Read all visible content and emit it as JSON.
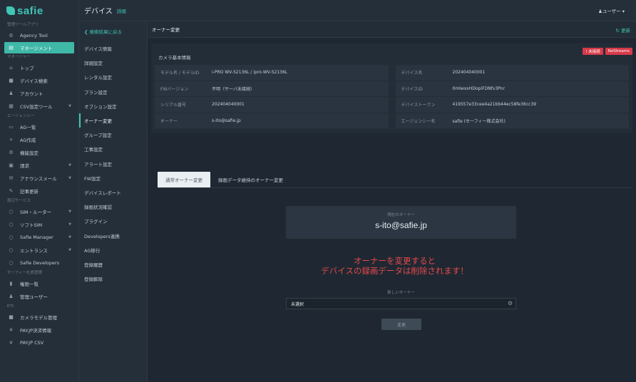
{
  "brand": "safie",
  "topbar": {
    "title": "デバイス",
    "subtitle": "詳細",
    "user": "♟ユーザー ▾"
  },
  "sidebar": {
    "sections": [
      {
        "title": "管理ツールアプリ",
        "items": [
          {
            "label": "Agency Tool",
            "icon": "tool-icon",
            "glyph": "⚙"
          },
          {
            "label": "マネージメント",
            "icon": "management-icon",
            "glyph": "▤",
            "active": true
          }
        ]
      },
      {
        "title": "マネージャー",
        "items": [
          {
            "label": "トップ",
            "icon": "home-icon",
            "glyph": "⌂"
          },
          {
            "label": "デバイス検索",
            "icon": "camera-icon",
            "glyph": "■"
          },
          {
            "label": "アカウント",
            "icon": "user-icon",
            "glyph": "♟"
          },
          {
            "label": "CSV設定ツール",
            "icon": "csv-icon",
            "glyph": "▦",
            "caret": true
          }
        ]
      },
      {
        "title": "エージェンシー",
        "items": [
          {
            "label": "AG一覧",
            "icon": "inbox-icon",
            "glyph": "▭"
          },
          {
            "label": "AG作成",
            "icon": "plus-icon",
            "glyph": "+"
          },
          {
            "label": "機能設定",
            "icon": "cogs-icon",
            "glyph": "⚙"
          },
          {
            "label": "請求",
            "icon": "invoice-icon",
            "glyph": "▣",
            "caret": true
          },
          {
            "label": "アナウンスメール",
            "icon": "mail-icon",
            "glyph": "✉",
            "caret": true
          },
          {
            "label": "記事更新",
            "icon": "edit-icon",
            "glyph": "✎"
          }
        ]
      },
      {
        "title": "周辺サービス",
        "items": [
          {
            "label": "SIM・ルーター",
            "icon": "circle-icon",
            "glyph": "○",
            "caret": true
          },
          {
            "label": "ソフトSIM",
            "icon": "circle-icon",
            "glyph": "○",
            "caret": true
          },
          {
            "label": "Safie Manager",
            "icon": "circle-icon",
            "glyph": "○",
            "caret": true
          },
          {
            "label": "エントランス",
            "icon": "circle-icon",
            "glyph": "○",
            "caret": true
          },
          {
            "label": "Safie Developers",
            "icon": "circle-icon",
            "glyph": "○"
          }
        ]
      },
      {
        "title": "セーフィー社員管理",
        "items": [
          {
            "label": "権限一覧",
            "icon": "lock-icon",
            "glyph": "▮"
          },
          {
            "label": "管理ユーザー",
            "icon": "user-icon",
            "glyph": "♟"
          }
        ]
      },
      {
        "title": "ETC",
        "items": [
          {
            "label": "カメラモデル管理",
            "icon": "video-icon",
            "glyph": "■"
          },
          {
            "label": "PAY.JP決済情報",
            "icon": "yen-icon",
            "glyph": "¥"
          },
          {
            "label": "PAY.JP CSV",
            "icon": "yen-icon",
            "glyph": "¥"
          }
        ]
      }
    ]
  },
  "subnav": {
    "back": "❮ 検索結果に戻る",
    "items": [
      "デバイス情報",
      "詳細設定",
      "レンタル設定",
      "プラン設定",
      "オプション設定",
      "オーナー変更",
      "グループ設定",
      "工事設定",
      "アラート設定",
      "FW設定",
      "デバイスレポート",
      "録画状況確認",
      "プラグイン",
      "Developers連携",
      "AG移行",
      "登録履歴",
      "登録解除"
    ],
    "active_index": 5
  },
  "panel": {
    "title": "オーナー変更",
    "refresh": "↻ 更新"
  },
  "camera_info": {
    "title": "カメラ基本情報",
    "badges": [
      "! 未接続",
      "NoStreams"
    ],
    "left": [
      {
        "k": "モデル名 / モデルID",
        "v": "i-PRO WV-S2136L / ipro-WV-S2136L"
      },
      {
        "k": "FWバージョン",
        "v": "不明（サーバ未接続）"
      },
      {
        "k": "シリアル番号",
        "v": "202404040001"
      },
      {
        "k": "オーナー",
        "v": "s-ito@safie.jp"
      }
    ],
    "right": [
      {
        "k": "デバイス名",
        "v": "202404040001"
      },
      {
        "k": "デバイスID",
        "v": "0mlwxxHDopiFDNfv3Pnr"
      },
      {
        "k": "デバイストークン",
        "v": "419557e33cee4a21bb44ec58fe36cc39"
      },
      {
        "k": "エージェンシー名",
        "v": "safie (セーフィー株式会社)"
      }
    ]
  },
  "tabs": [
    {
      "label": "通常オーナー変更",
      "active": true
    },
    {
      "label": "録画データ維持のオーナー変更",
      "active": false
    }
  ],
  "current_owner": {
    "label": "現在のオーナー",
    "value": "s-ito@safie.jp"
  },
  "warning": {
    "line1": "オーナーを変更すると",
    "line2": "デバイスの録画データは削除されます！"
  },
  "new_owner": {
    "label": "新しいオーナー",
    "value": "未選択"
  },
  "change_button": "変更",
  "colors": {
    "accent": "#3fc6b5",
    "danger": "#e5484d",
    "bg": "#1f2832"
  }
}
